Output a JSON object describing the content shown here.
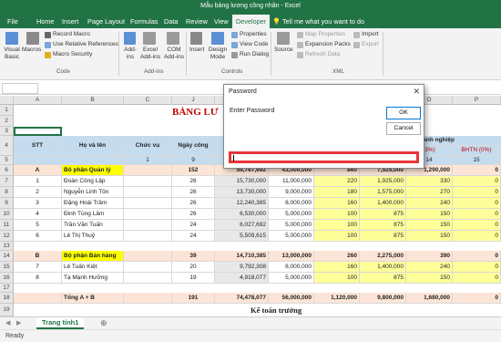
{
  "window": {
    "title": "Mẫu bảng lương công nhân  -  Excel"
  },
  "tabs": [
    "File",
    "Home",
    "Insert",
    "Page Layout",
    "Formulas",
    "Data",
    "Review",
    "View",
    "Developer"
  ],
  "tell_me": "Tell me what you want to do",
  "ribbon": {
    "code": {
      "visual_basic": "Visual Basic",
      "macros": "Macros",
      "record_macro": "Record Macro",
      "relative_refs": "Use Relative References",
      "macro_security": "Macro Security",
      "label": "Code"
    },
    "addins": {
      "addins": "Add-ins",
      "excel_addins": "Excel Add-ins",
      "com_addins": "COM Add-ins",
      "label": "Add-ins"
    },
    "controls": {
      "insert": "Insert",
      "design_mode": "Design Mode",
      "properties": "Properties",
      "view_code": "View Code",
      "run_dialog": "Run Dialog",
      "label": "Controls"
    },
    "xml": {
      "source": "Source",
      "map_properties": "Map Properties",
      "expansion_packs": "Expansion Packs",
      "refresh_data": "Refresh Data",
      "import": "Import",
      "export": "Export",
      "label": "XML"
    }
  },
  "columns": [
    "A",
    "B",
    "C",
    "J",
    "K",
    "L",
    "M",
    "N",
    "O",
    "P"
  ],
  "rows": [
    "1",
    "2",
    "3",
    "4",
    "5",
    "6",
    "7",
    "8",
    "9",
    "10",
    "11",
    "12",
    "13",
    "14",
    "15",
    "16",
    "17",
    "18",
    "19"
  ],
  "sheet": {
    "title": "BẢNG LƯ",
    "headers": {
      "stt": "STT",
      "name": "Họ và tên",
      "position": "Chức vụ",
      "days": "Ngày công",
      "company_pays": "hi Doanh nghiệp",
      "pct": "(3%)",
      "bhtn": "BHTN (0%)"
    },
    "row5": [
      "1",
      "9",
      "14",
      "15"
    ],
    "sections": [
      {
        "code": "A",
        "label": "Bộ phận Quản lý",
        "days": "152",
        "j": "59,767,692",
        "k": "43,000,000",
        "l": "860",
        "m": "7,525,000",
        "n": "1,290,000",
        "p": "0"
      },
      {
        "code": "B",
        "label": "Bộ phận Bán hàng",
        "days": "39",
        "j": "14,710,385",
        "k": "13,000,000",
        "l": "260",
        "m": "2,275,000",
        "n": "390",
        "p": "0"
      }
    ],
    "employees": [
      {
        "stt": "1",
        "name": "Đoàn Công Lập",
        "days": "26",
        "j": "15,730,000",
        "k": "11,000,000",
        "l": "220",
        "m": "1,925,000",
        "n": "330",
        "p": "0"
      },
      {
        "stt": "2",
        "name": "Nguyễn Linh Tôn",
        "days": "26",
        "j": "13,730,000",
        "k": "9,000,000",
        "l": "180",
        "m": "1,575,000",
        "n": "270",
        "p": "0"
      },
      {
        "stt": "3",
        "name": "Đặng Hoài Trâm",
        "days": "26",
        "j": "12,240,385",
        "k": "8,000,000",
        "l": "160",
        "m": "1,400,000",
        "n": "240",
        "p": "0"
      },
      {
        "stt": "4",
        "name": "Đinh Tùng Lâm",
        "days": "26",
        "j": "6,530,000",
        "k": "5,000,000",
        "l": "100",
        "m": "875",
        "n": "150",
        "p": "0"
      },
      {
        "stt": "5",
        "name": "Trần Văn Tuấn",
        "days": "24",
        "j": "6,027,692",
        "k": "5,000,000",
        "l": "100",
        "m": "875",
        "n": "150",
        "p": "0"
      },
      {
        "stt": "6",
        "name": "Lê Thị Thuỷ",
        "days": "24",
        "j": "5,509,615",
        "k": "5,000,000",
        "l": "100",
        "m": "875",
        "n": "150",
        "p": "0"
      },
      {
        "stt": "7",
        "name": "Lê Tuấn Kiệt",
        "days": "20",
        "j": "9,792,308",
        "k": "8,000,000",
        "l": "160",
        "m": "1,400,000",
        "n": "240",
        "p": "0"
      },
      {
        "stt": "8",
        "name": "Tạ Mạnh Hưởng",
        "days": "19",
        "j": "4,918,077",
        "k": "5,000,000",
        "l": "100",
        "m": "875",
        "n": "150",
        "p": "0"
      }
    ],
    "total": {
      "label": "Tổng A + B",
      "days": "191",
      "j": "74,478,077",
      "k": "56,000,000",
      "l": "1,120,000",
      "m": "9,800,000",
      "n": "1,680,000",
      "p": "0"
    },
    "footer": "Kế toán trưởng"
  },
  "sheet_tab": "Trang tính1",
  "status": "Ready",
  "dialog": {
    "title": "Password",
    "prompt": "Enter Password",
    "ok": "OK",
    "cancel": "Cancel",
    "value": ""
  },
  "colors": {
    "excel_green": "#217346",
    "highlight_yellow": "#ffff99",
    "header_blue": "#c5dcef",
    "section_orange": "#fce4d6",
    "title_red": "#c00000",
    "callout_red": "#e8343a"
  }
}
